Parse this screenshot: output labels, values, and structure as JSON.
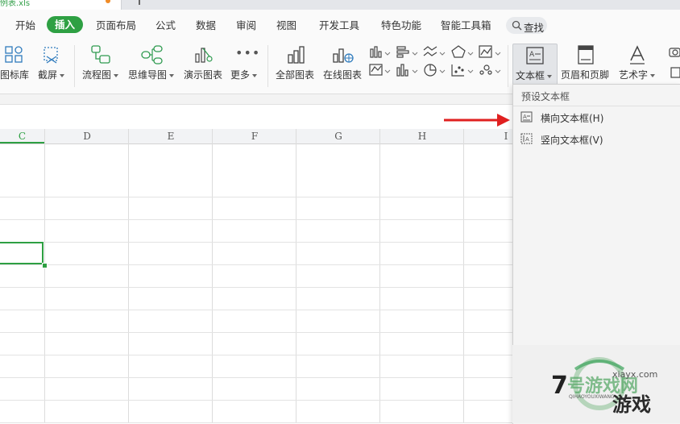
{
  "file_tab": {
    "name": "例表.xls"
  },
  "menu": {
    "items": [
      "开始",
      "插入",
      "页面布局",
      "公式",
      "数据",
      "审阅",
      "视图",
      "开发工具",
      "特色功能",
      "智能工具箱"
    ],
    "active": "插入",
    "search_label": "查找"
  },
  "ribbon": {
    "buttons": {
      "icon_lib": "图标库",
      "screenshot": "截屏",
      "flowchart": "流程图",
      "mindmap": "思维导图",
      "demo_chart": "演示图表",
      "more": "更多",
      "all_charts": "全部图表",
      "online_charts": "在线图表",
      "text_box": "文本框",
      "header_footer": "页眉和页脚",
      "art_text": "艺术字"
    }
  },
  "sheet": {
    "columns": [
      "C",
      "D",
      "E",
      "F",
      "G",
      "H",
      "I"
    ]
  },
  "dropdown": {
    "header": "预设文本框",
    "items": [
      {
        "label": "横向文本框(H)",
        "icon": "horizontal-textbox-icon"
      },
      {
        "label": "竖向文本框(V)",
        "icon": "vertical-textbox-icon"
      }
    ]
  },
  "watermark": {
    "line1": "7号游戏网",
    "line2": "游戏",
    "domain": "xiayx.com",
    "pinyin": "QIHAOYOUXIWANG"
  },
  "colors": {
    "accent_green": "#2ea043",
    "arrow_red": "#e02020"
  }
}
